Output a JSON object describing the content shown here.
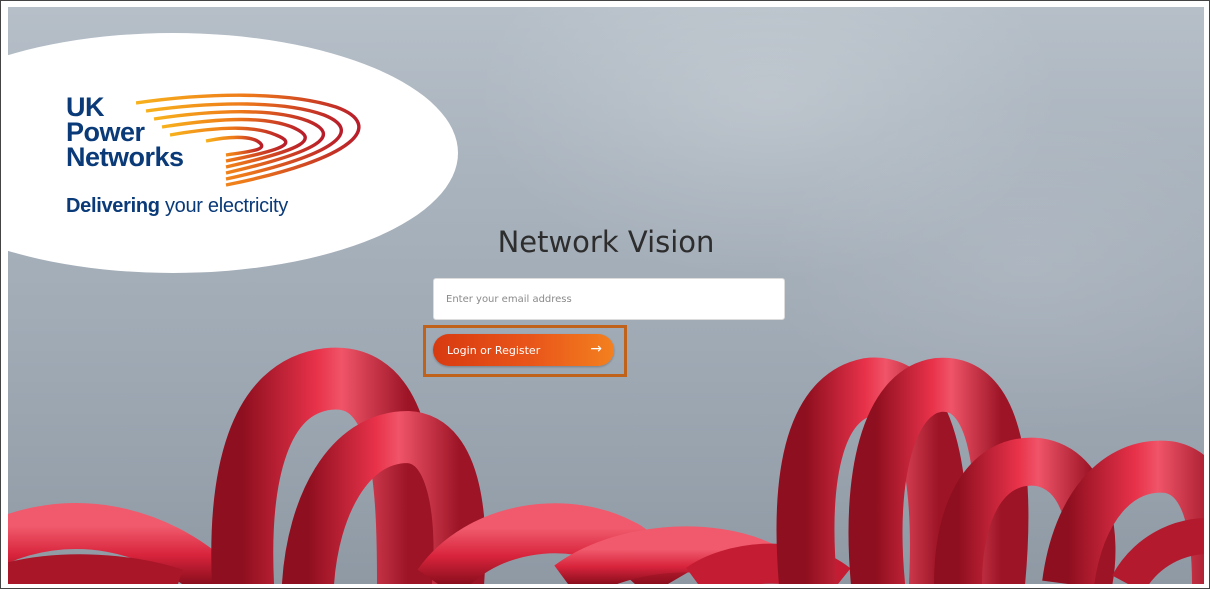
{
  "brand": {
    "logo_line1": "UK",
    "logo_line2": "Power",
    "logo_line3": "Networks",
    "tagline_bold": "Delivering",
    "tagline_rest": " your electricity",
    "logo_colors": [
      "#0a3a78",
      "#f6a21a",
      "#b81d2a"
    ]
  },
  "page": {
    "title": "Network Vision"
  },
  "login_form": {
    "email_placeholder": "Enter your email address",
    "email_value": "",
    "submit_label": "Login or Register",
    "submit_icon": "arrow-right-icon",
    "accent_color": "#e9561a",
    "highlight_color": "#c0621a"
  },
  "background": {
    "subject": "red-cables",
    "sky_color": "#a9b3bd",
    "cable_color": "#d6223a"
  }
}
